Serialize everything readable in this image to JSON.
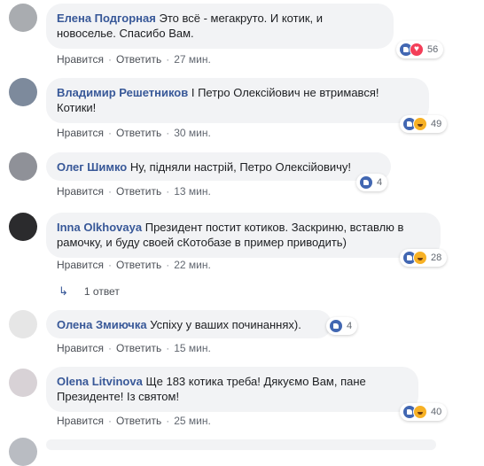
{
  "comments": [
    {
      "author": "Елена Подгорная",
      "text": "Это всё - мегакруто. И котик, и новоселье. Спасибо Вам.",
      "like_label": "Нравится",
      "reply_label": "Ответить",
      "time": "27 мин.",
      "reactions": [
        "like",
        "love"
      ],
      "reaction_count": "56"
    },
    {
      "author": "Владимир Решетников",
      "text": "І Петро Олексійович не втримався! Котики!",
      "like_label": "Нравится",
      "reply_label": "Ответить",
      "time": "30 мин.",
      "reactions": [
        "like",
        "haha"
      ],
      "reaction_count": "49"
    },
    {
      "author": "Олег Шимко",
      "text": "Ну, підняли настрій, Петро Олексійовичу!",
      "like_label": "Нравится",
      "reply_label": "Ответить",
      "time": "13 мин.",
      "reactions": [
        "like"
      ],
      "reaction_count": "4"
    },
    {
      "author": "Inna Olkhovaya",
      "text": "Президент постит котиков. Заскриню, вставлю в рамочку, и буду своей сКотобазе в пример приводить)",
      "like_label": "Нравится",
      "reply_label": "Ответить",
      "time": "22 мин.",
      "reactions": [
        "like",
        "haha"
      ],
      "reaction_count": "28"
    },
    {
      "author": "Олена Змиючка",
      "text": "Успіху у ваших починаннях).",
      "like_label": "Нравится",
      "reply_label": "Ответить",
      "time": "15 мин.",
      "reactions": [
        "like"
      ],
      "reaction_count": "4"
    },
    {
      "author": "Olena Litvinova",
      "text": "Ще 183 котика треба! Дякуємо Вам, пане Президенте! Із святом!",
      "like_label": "Нравится",
      "reply_label": "Ответить",
      "time": "25 мин.",
      "reactions": [
        "like",
        "haha"
      ],
      "reaction_count": "40"
    }
  ],
  "replies_link": "1 ответ",
  "colors": {
    "author": "#385898",
    "bubble": "#f2f3f5",
    "like": "#4267b2",
    "love": "#f33e58",
    "haha": "#f7b125"
  }
}
